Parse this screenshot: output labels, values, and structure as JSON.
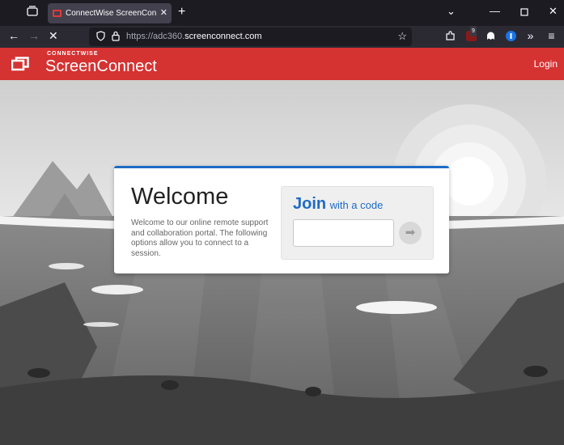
{
  "browser": {
    "tab_title": "ConnectWise ScreenConnect Re",
    "tab_close": "✕",
    "new_tab": "+",
    "url_prefix": "https://adc360.",
    "url_domain": "screenconnect.com",
    "ext_badge": "9",
    "icons": [
      "tab-list-icon",
      "back-icon",
      "forward-icon",
      "stop-icon",
      "shield-icon",
      "lock-icon",
      "star-icon",
      "extension-icon",
      "ublock-icon",
      "ghost-icon",
      "password-icon",
      "overflow-icon",
      "menu-icon"
    ]
  },
  "header": {
    "brand_small": "CONNECTWISE",
    "brand_big": "ScreenConnect",
    "login": "Login",
    "color": "#d53232"
  },
  "welcome": {
    "title": "Welcome",
    "text": "Welcome to our online remote support and collaboration portal. The following options allow you to connect to a session."
  },
  "join": {
    "big": "Join",
    "small": "with a code",
    "code_value": "",
    "accent": "#1e6bc5"
  }
}
